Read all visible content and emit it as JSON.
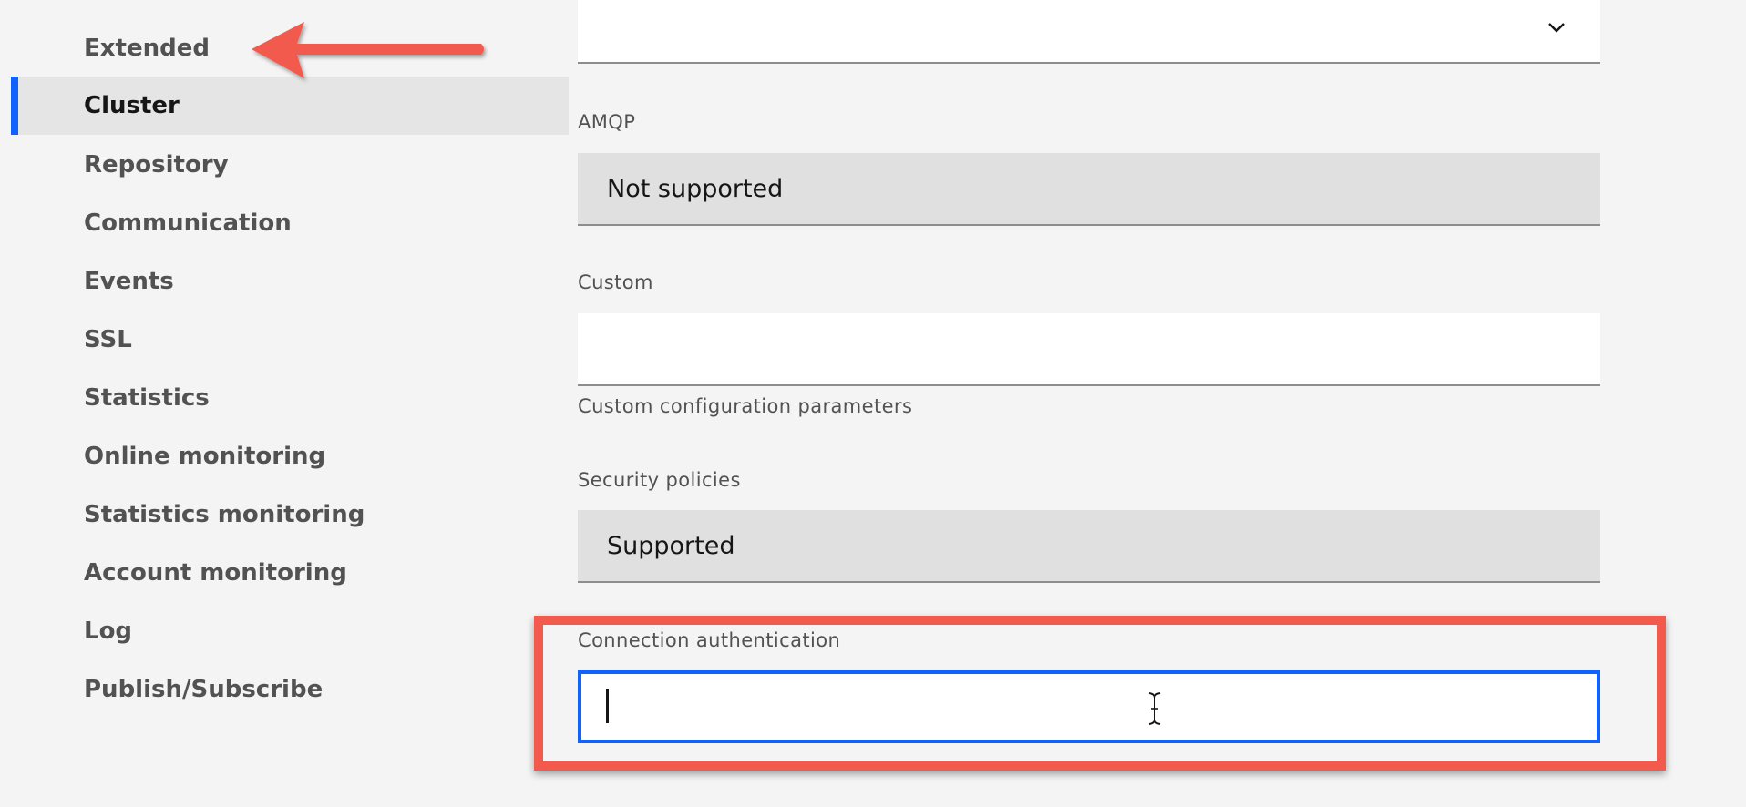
{
  "sidebar": {
    "items": [
      {
        "label": "Extended",
        "active": false
      },
      {
        "label": "Cluster",
        "active": true
      },
      {
        "label": "Repository",
        "active": false
      },
      {
        "label": "Communication",
        "active": false
      },
      {
        "label": "Events",
        "active": false
      },
      {
        "label": "SSL",
        "active": false
      },
      {
        "label": "Statistics",
        "active": false
      },
      {
        "label": "Online monitoring",
        "active": false
      },
      {
        "label": "Statistics monitoring",
        "active": false
      },
      {
        "label": "Account monitoring",
        "active": false
      },
      {
        "label": "Log",
        "active": false
      },
      {
        "label": "Publish/Subscribe",
        "active": false
      }
    ]
  },
  "form": {
    "select": {
      "value": "",
      "icon": "chevron-down-icon"
    },
    "amqp": {
      "label": "AMQP",
      "value": "Not supported"
    },
    "custom": {
      "label": "Custom",
      "value": "",
      "helper": "Custom configuration parameters"
    },
    "security_policies": {
      "label": "Security policies",
      "value": "Supported"
    },
    "connection_authentication": {
      "label": "Connection authentication",
      "value": ""
    }
  },
  "colors": {
    "accent": "#0f62fe",
    "annotation": "#f25a4e",
    "background": "#f4f4f4"
  }
}
